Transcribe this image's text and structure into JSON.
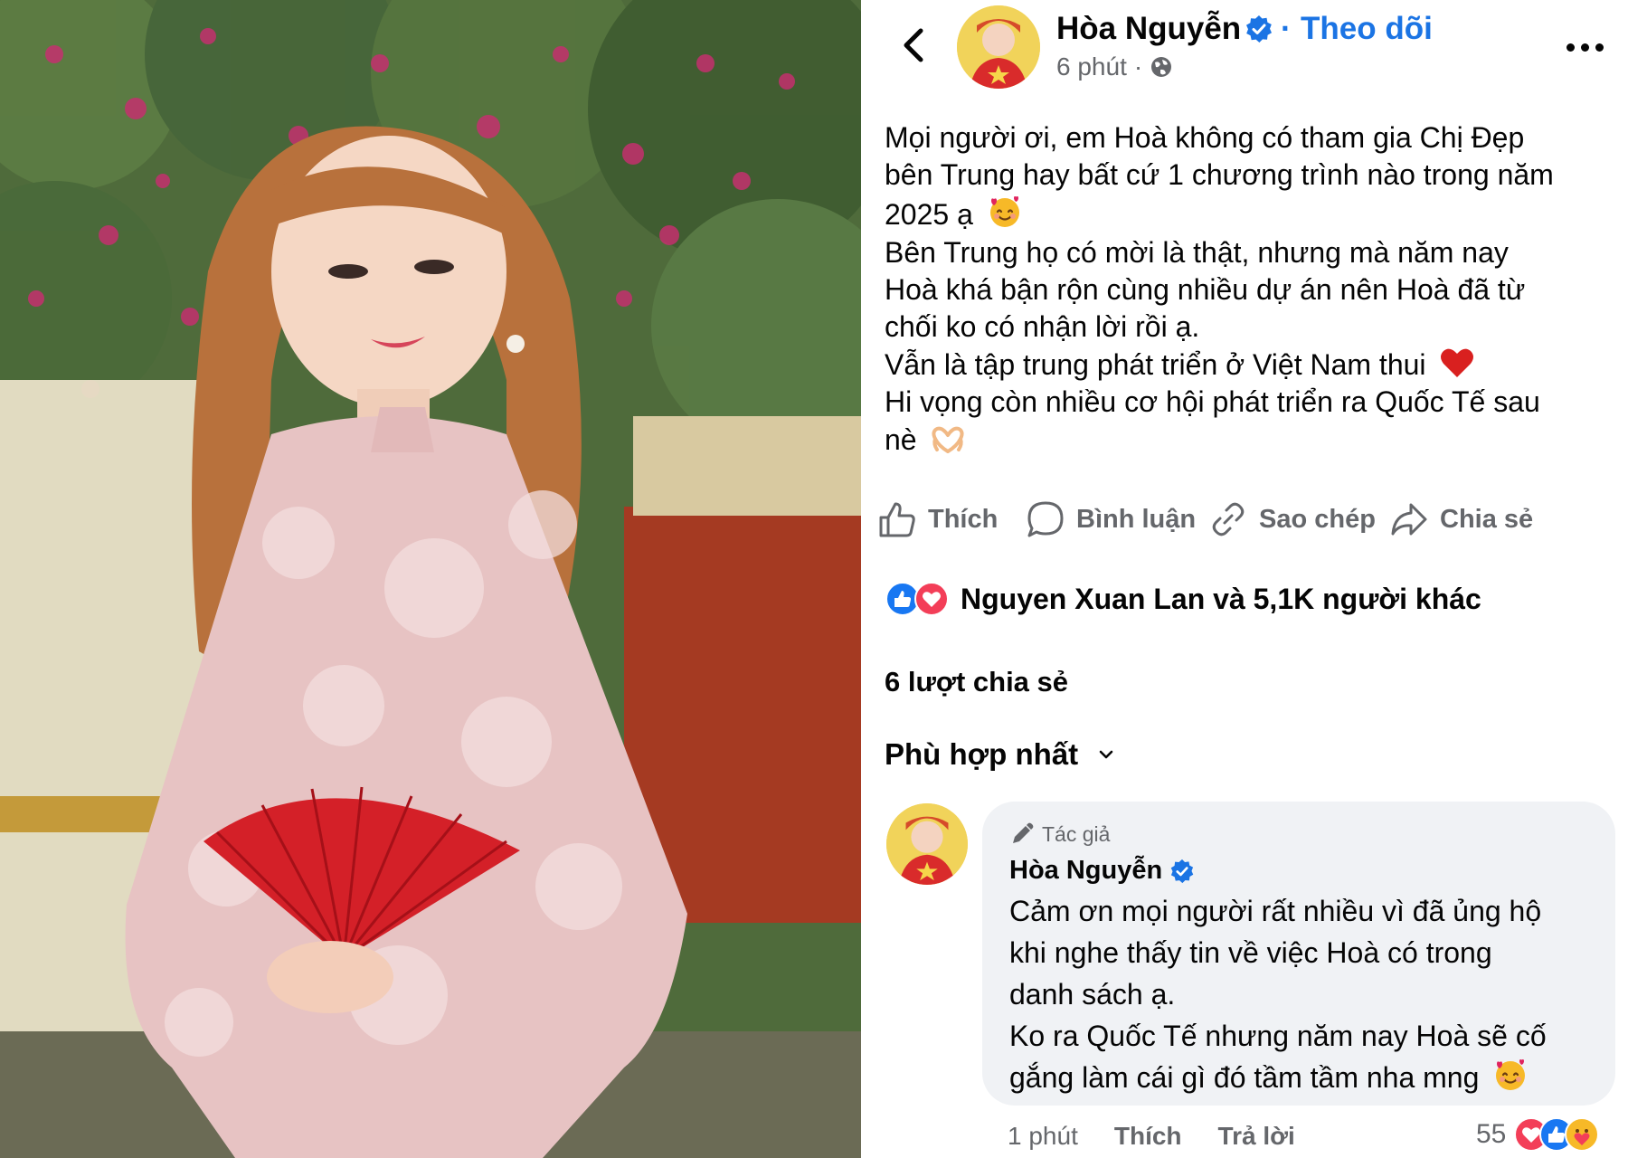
{
  "post": {
    "author": "Hòa Nguyễn",
    "separator": "·",
    "follow_label": "Theo dõi",
    "time": "6 phút",
    "meta_separator": "·",
    "lines": [
      "Mọi người ơi, em Hoà không có tham gia Chị Đẹp",
      "bên Trung hay bất cứ 1 chương trình nào trong năm",
      "2025 ạ",
      "Bên Trung họ có mời là thật, nhưng mà năm nay",
      "Hoà khá bận rộn cùng nhiều dự án nên Hoà đã từ",
      "chối ko có nhận lời rồi ạ.",
      "Vẫn là tập trung phát triển ở Việt Nam thui",
      "Hi vọng còn nhiều cơ hội phát triển ra Quốc Tế sau",
      "nè"
    ],
    "emojis": {
      "line3": "smiling-face-with-hearts",
      "line7": "red-heart",
      "line9": "heart-hands"
    }
  },
  "actions": {
    "like": "Thích",
    "comment": "Bình luận",
    "copy": "Sao chép",
    "share": "Chia sẻ"
  },
  "reactions": {
    "icons": [
      "like",
      "love"
    ],
    "text": "Nguyen Xuan Lan và 5,1K người khác"
  },
  "shares_text": "6 lượt chia sẻ",
  "sort_label": "Phù hợp nhất",
  "comment": {
    "badge": "Tác giả",
    "author": "Hòa Nguyễn",
    "lines": [
      "Cảm ơn mọi người rất nhiều vì đã ủng hộ",
      "khi nghe thấy tin về việc Hoà có trong",
      "danh sách ạ.",
      "Ko ra Quốc Tế nhưng năm nay Hoà sẽ cố",
      "gắng làm cái gì đó tầm tầm nha mng"
    ],
    "time": "1 phút",
    "like_label": "Thích",
    "reply_label": "Trả lời",
    "reaction_count": "55",
    "reaction_icons": [
      "love",
      "like",
      "care"
    ]
  },
  "colors": {
    "facebook_blue": "#1b74e4",
    "secondary_text": "#65676b",
    "bubble_bg": "#f0f2f5",
    "love_red": "#f33e58",
    "like_blue": "#1877f2"
  }
}
